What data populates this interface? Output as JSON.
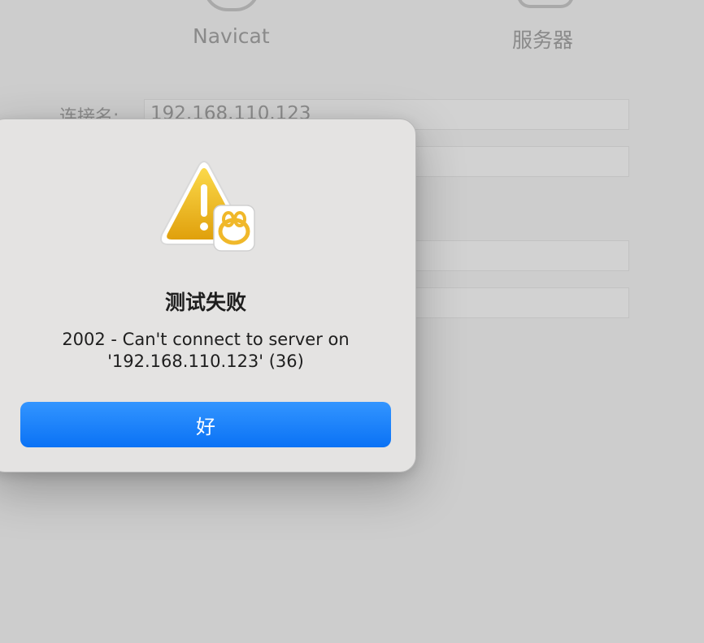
{
  "background_window": {
    "tabs": [
      {
        "label": "Navicat",
        "icon": "navicat-icon"
      },
      {
        "label": "服务器",
        "icon": "server-icon"
      }
    ],
    "connection_name_label": "连接名:",
    "connection_name_value": "192.168.110.123"
  },
  "alert": {
    "icon": "warning-icon",
    "badge_icon": "navicat-app-icon",
    "title": "测试失败",
    "message_line1": "2002 - Can't connect to server on",
    "message_line2": "'192.168.110.123' (36)",
    "ok_label": "好"
  },
  "colors": {
    "accent": "#0a72f5",
    "warning": "#f2c01c",
    "dialog_bg": "#e4e3e2",
    "window_bg": "#cdcdcd"
  }
}
